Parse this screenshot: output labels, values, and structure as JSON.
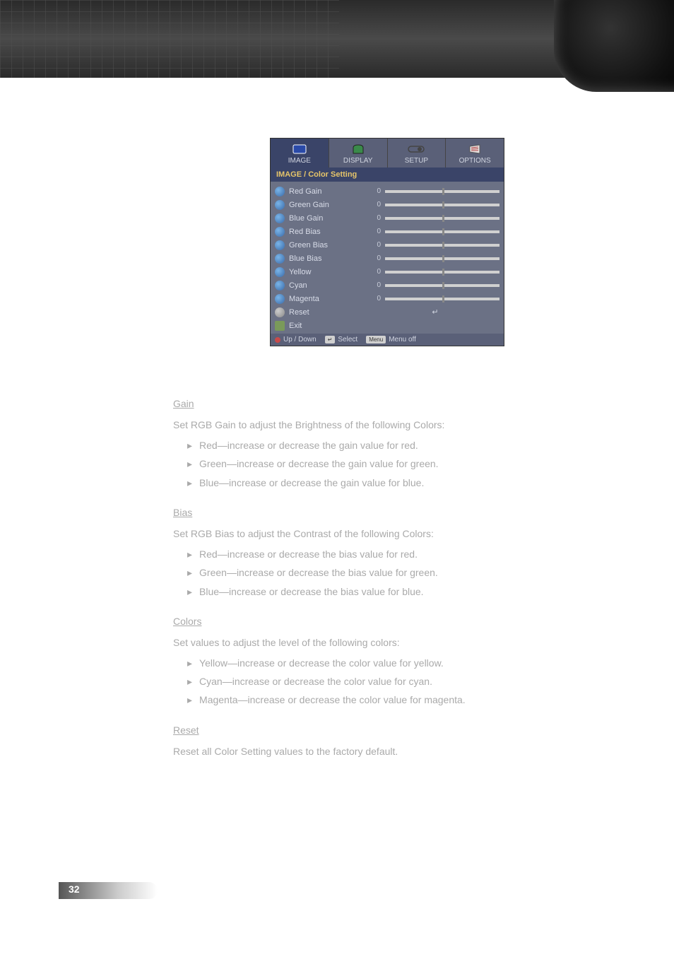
{
  "osd": {
    "tabs": [
      "IMAGE",
      "DISPLAY",
      "SETUP",
      "OPTIONS"
    ],
    "title": "IMAGE / Color Setting",
    "rows": [
      {
        "label": "Red Gain",
        "value": "0"
      },
      {
        "label": "Green Gain",
        "value": "0"
      },
      {
        "label": "Blue Gain",
        "value": "0"
      },
      {
        "label": "Red Bias",
        "value": "0"
      },
      {
        "label": "Green Bias",
        "value": "0"
      },
      {
        "label": "Blue Bias",
        "value": "0"
      },
      {
        "label": "Yellow",
        "value": "0"
      },
      {
        "label": "Cyan",
        "value": "0"
      },
      {
        "label": "Magenta",
        "value": "0"
      }
    ],
    "reset_label": "Reset",
    "exit_label": "Exit",
    "footer": {
      "updown": "Up / Down",
      "select": "Select",
      "menu_key": "Menu",
      "menuoff": "Menu off"
    }
  },
  "sections": {
    "gain": {
      "heading": "Gain",
      "desc": "Set RGB Gain to adjust the Brightness of the following Colors:",
      "items": [
        "Red—increase or decrease the gain value for red.",
        "Green—increase or decrease the gain value for green.",
        "Blue—increase or decrease the gain value for blue."
      ]
    },
    "bias": {
      "heading": "Bias",
      "desc": "Set RGB Bias to adjust the Contrast of the following Colors:",
      "items": [
        "Red—increase or decrease the bias value for red.",
        "Green—increase or decrease the bias value for green.",
        "Blue—increase or decrease the bias value for blue."
      ]
    },
    "colors": {
      "heading": "Colors",
      "desc": "Set values to adjust the level of the following colors:",
      "items": [
        "Yellow—increase or decrease the color value for yellow.",
        "Cyan—increase or decrease the color value for cyan.",
        "Magenta—increase or decrease the color value for magenta."
      ]
    },
    "reset": {
      "heading": "Reset",
      "desc": "Reset all Color Setting values to the factory default."
    }
  },
  "page_number": "32"
}
